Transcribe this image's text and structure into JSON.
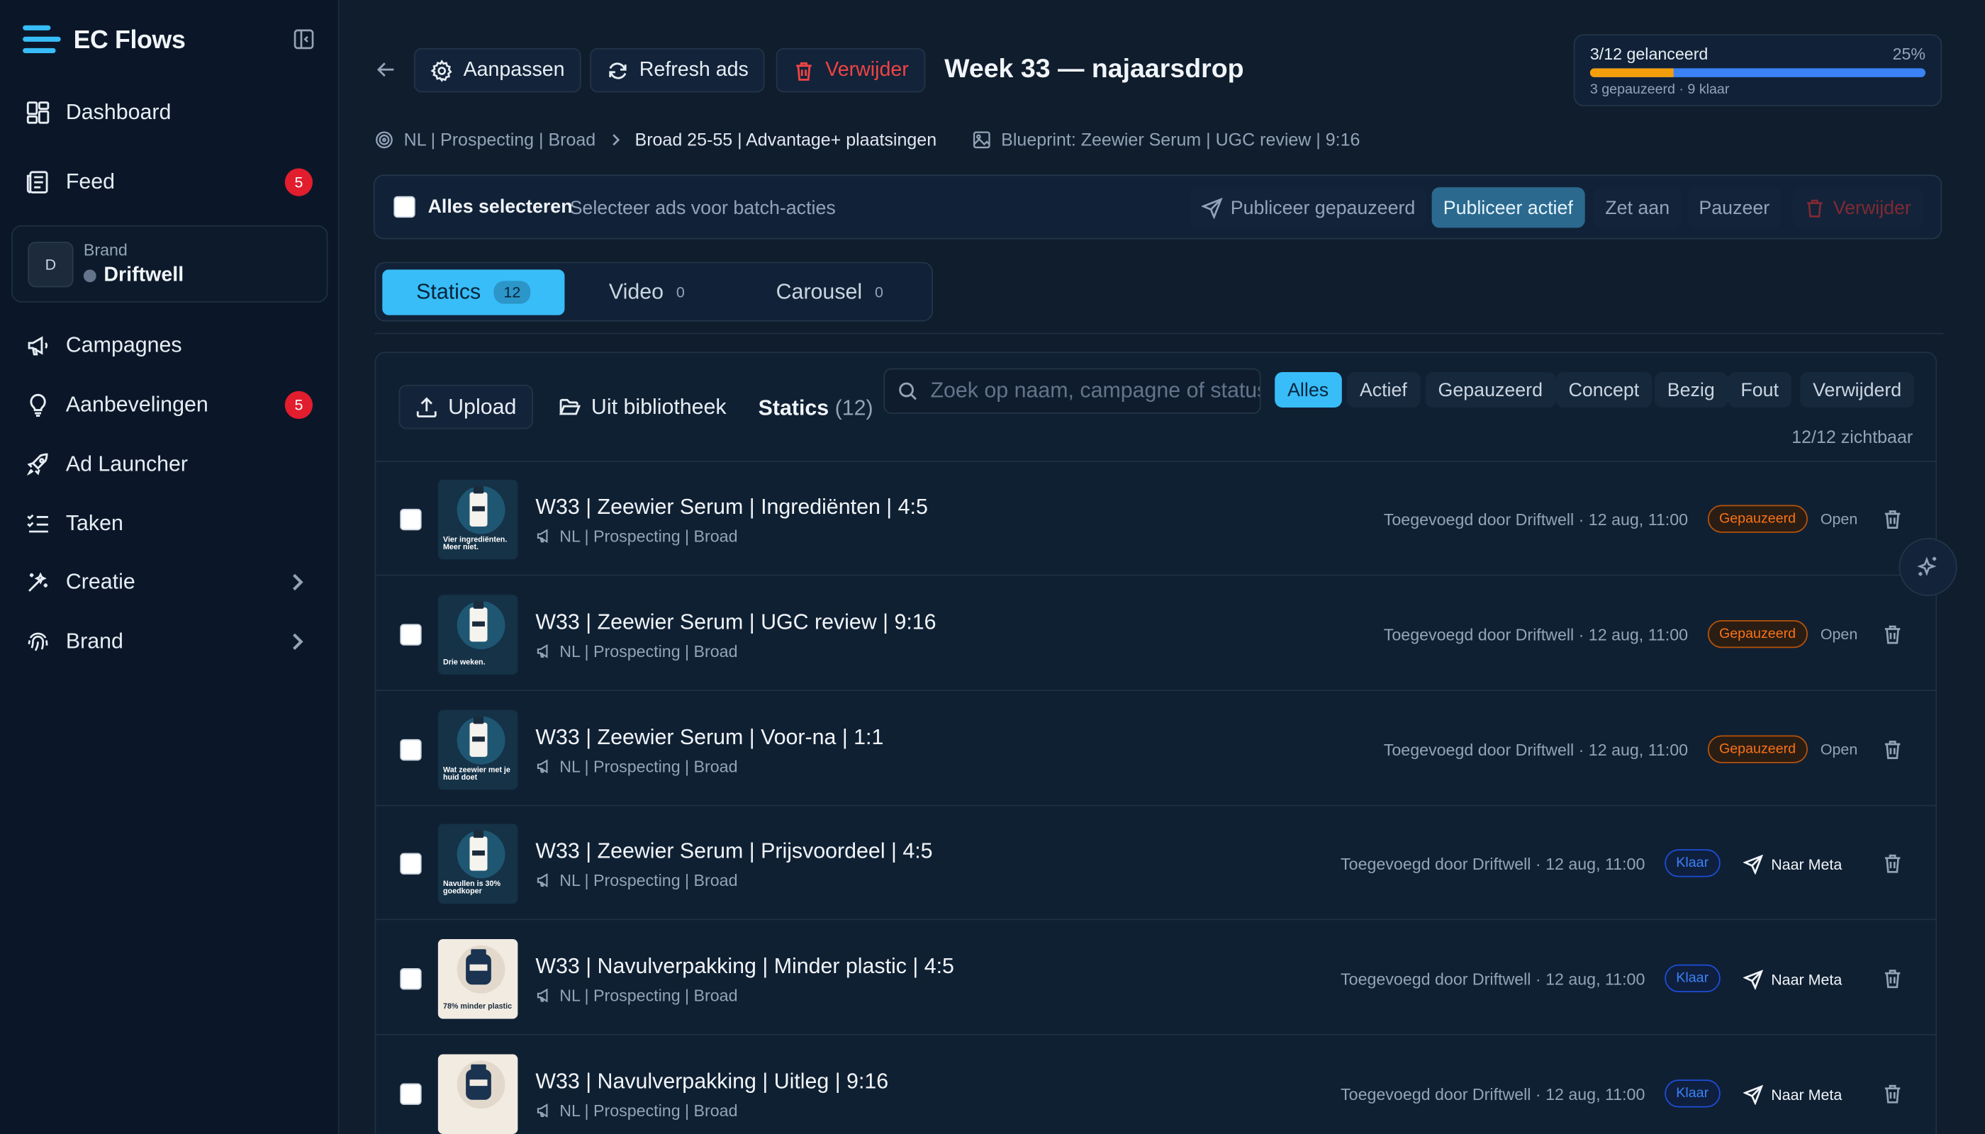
{
  "app": {
    "title": "EC Flows"
  },
  "sidebar": {
    "items": [
      {
        "label": "Dashboard",
        "icon": "dashboard-icon"
      },
      {
        "label": "Feed",
        "icon": "feed-icon",
        "badge": "5"
      },
      {
        "label": "Campagnes",
        "icon": "megaphone-icon"
      },
      {
        "label": "Aanbevelingen",
        "icon": "lightbulb-icon",
        "badge": "5"
      },
      {
        "label": "Ad Launcher",
        "icon": "rocket-icon"
      },
      {
        "label": "Taken",
        "icon": "tasks-icon"
      },
      {
        "label": "Creatie",
        "icon": "magic-wand-icon"
      },
      {
        "label": "Brand",
        "icon": "fingerprint-icon"
      }
    ],
    "brand": {
      "label": "Brand",
      "initial": "D",
      "name": "Driftwell"
    }
  },
  "toolbar": {
    "edit_label": "Aanpassen",
    "refresh_label": "Refresh ads",
    "delete_label": "Verwijder",
    "page_title": "Week 33 — najaarsdrop"
  },
  "progress": {
    "label": "3/12 gelanceerd",
    "percent": "25%",
    "value": 0.25,
    "sub": "3 gepauzeerd · 9 klaar"
  },
  "breadcrumb": {
    "campaign": "NL | Prospecting | Broad",
    "adset": "Broad 25-55 | Advantage+ plaatsingen",
    "blueprint": "Blueprint: Zeewier Serum | UGC review | 9:16"
  },
  "batch": {
    "select_all": "Alles selecteren",
    "hint": "Selecteer ads voor batch-acties",
    "publish_paused": "Publiceer gepauzeerd",
    "publish_active": "Publiceer actief",
    "turn_on": "Zet aan",
    "pause": "Pauzeer",
    "delete": "Verwijder"
  },
  "tabs": [
    {
      "label": "Statics",
      "count": "12"
    },
    {
      "label": "Video",
      "count": "0"
    },
    {
      "label": "Carousel",
      "count": "0"
    }
  ],
  "panel": {
    "upload": "Upload",
    "library": "Uit bibliotheek",
    "title": "Statics",
    "title_count": "(12)",
    "search_placeholder": "Zoek op naam, campagne of status",
    "filters": [
      "Alles",
      "Actief",
      "Gepauzeerd",
      "Concept",
      "Bezig",
      "Fout",
      "Verwijderd"
    ],
    "visible": "12/12 zichtbaar"
  },
  "rows": [
    {
      "title": "W33 | Zeewier Serum | Ingrediënten | 4:5",
      "sub": "NL | Prospecting | Broad",
      "meta": "Toegevoegd door Driftwell · 12 aug, 11:00",
      "status": "Gepauzeerd",
      "action": "Open",
      "thumb_text": "Vier ingrediënten. Meer niet."
    },
    {
      "title": "W33 | Zeewier Serum | UGC review | 9:16",
      "sub": "NL | Prospecting | Broad",
      "meta": "Toegevoegd door Driftwell · 12 aug, 11:00",
      "status": "Gepauzeerd",
      "action": "Open",
      "thumb_text": "Drie weken."
    },
    {
      "title": "W33 | Zeewier Serum | Voor-na | 1:1",
      "sub": "NL | Prospecting | Broad",
      "meta": "Toegevoegd door Driftwell · 12 aug, 11:00",
      "status": "Gepauzeerd",
      "action": "Open",
      "thumb_text": "Wat zeewier met je huid doet"
    },
    {
      "title": "W33 | Zeewier Serum | Prijsvoordeel | 4:5",
      "sub": "NL | Prospecting | Broad",
      "meta": "Toegevoegd door Driftwell · 12 aug, 11:00",
      "status": "Klaar",
      "action": "Naar Meta",
      "thumb_text": "Navullen is 30% goedkoper"
    },
    {
      "title": "W33 | Navulverpakking | Minder plastic | 4:5",
      "sub": "NL | Prospecting | Broad",
      "meta": "Toegevoegd door Driftwell · 12 aug, 11:00",
      "status": "Klaar",
      "action": "Naar Meta",
      "thumb_text": "78% minder plastic"
    },
    {
      "title": "W33 | Navulverpakking | Uitleg | 9:16",
      "sub": "NL | Prospecting | Broad",
      "meta": "Toegevoegd door Driftwell · 12 aug, 11:00",
      "status": "Klaar",
      "action": "Naar Meta",
      "thumb_text": ""
    }
  ],
  "colors": {
    "accent": "#38bdf8",
    "danger": "#ef4444",
    "paused": "#f97316",
    "ready": "#3b82f6",
    "bg": "#0f1d2d"
  }
}
